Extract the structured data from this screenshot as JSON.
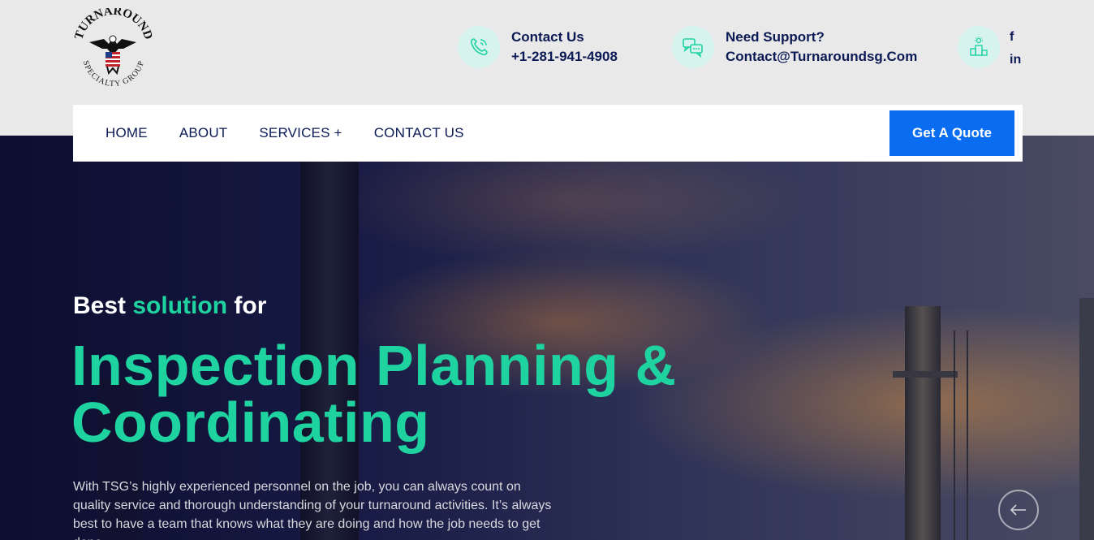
{
  "logo": {
    "name_line1": "TURNAROUND",
    "name_line2": "SPECIALTY GROUP"
  },
  "contacts": [
    {
      "icon": "phone-icon",
      "label": "Contact Us",
      "value": "+1-281-941-4908"
    },
    {
      "icon": "chat-icon",
      "label": "Need Support?",
      "value": "Contact@Turnaroundsg.Com"
    }
  ],
  "social": {
    "icon": "podium-icon",
    "facebook": "f",
    "linkedin": "in"
  },
  "nav": {
    "items": [
      "HOME",
      "ABOUT",
      "SERVICES +",
      "CONTACT US"
    ],
    "cta": "Get A Quote"
  },
  "hero": {
    "kicker_part1": "Best",
    "kicker_accent": "solution",
    "kicker_part2": "for",
    "headline_white": "Inspection ",
    "headline_green": "Planning & Coordinating",
    "description": "With TSG’s highly experienced personnel on the job, you can always count on quality service and thorough understanding of your turnaround activities. It’s always best to have a team that knows what they are doing and how the job needs to get done"
  },
  "colors": {
    "navy": "#0b1a55",
    "accent_green": "#1fd3a0",
    "cta_blue": "#0a6cf0",
    "icon_bg": "#d6f3ee"
  }
}
